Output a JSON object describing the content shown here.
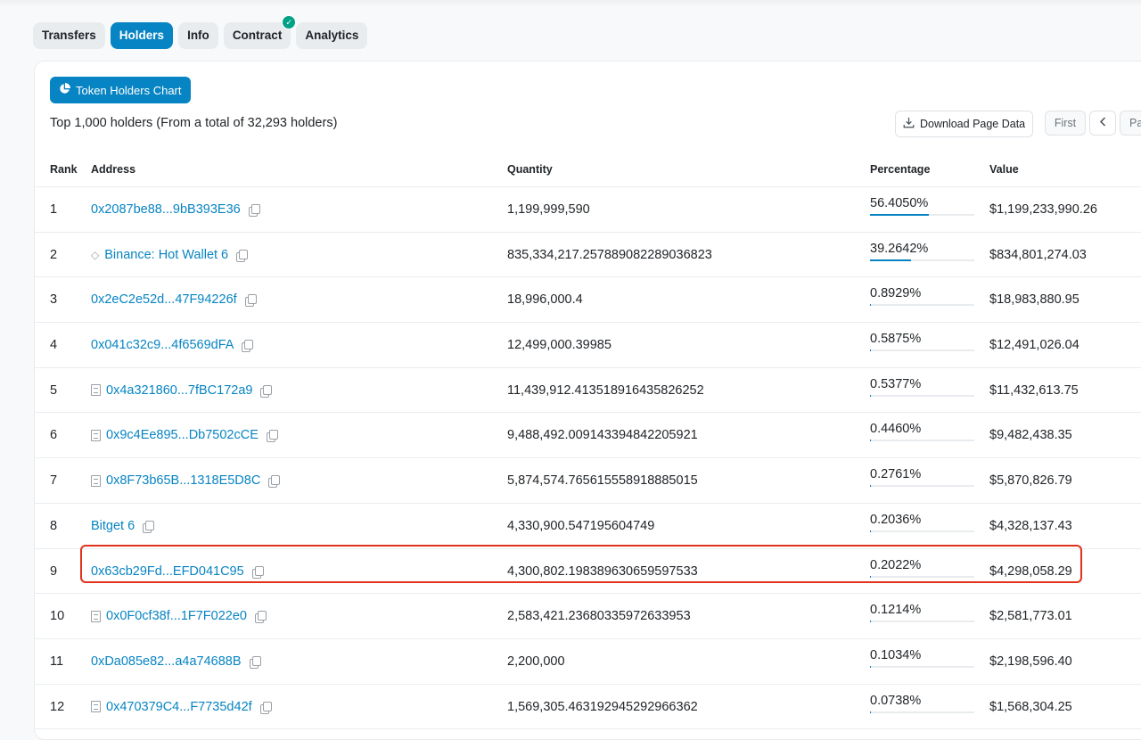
{
  "tabs": [
    {
      "label": "Transfers",
      "active": false
    },
    {
      "label": "Holders",
      "active": true
    },
    {
      "label": "Info",
      "active": false
    },
    {
      "label": "Contract",
      "active": false,
      "verified": true
    },
    {
      "label": "Analytics",
      "active": false
    }
  ],
  "chart_button": {
    "label": "Token Holders Chart",
    "icon": "pie-chart-icon"
  },
  "summary": "Top 1,000 holders (From a total of 32,293 holders)",
  "download_button": {
    "label": "Download Page Data",
    "icon": "download-icon"
  },
  "pagination": {
    "first": "First",
    "prev": "<",
    "page_partial": "Pa"
  },
  "table": {
    "headers": {
      "rank": "Rank",
      "address": "Address",
      "quantity": "Quantity",
      "percentage": "Percentage",
      "value": "Value"
    },
    "rows": [
      {
        "rank": "1",
        "address": "0x2087be88...9bB393E36",
        "icon": "none",
        "quantity": "1,199,999,590",
        "percentage": "56.4050%",
        "pct": 56.405,
        "value": "$1,199,233,990.26"
      },
      {
        "rank": "2",
        "address": "Binance: Hot Wallet 6",
        "icon": "label",
        "quantity": "835,334,217.257889082289036823",
        "percentage": "39.2642%",
        "pct": 39.2642,
        "value": "$834,801,274.03"
      },
      {
        "rank": "3",
        "address": "0x2eC2e52d...47F94226f",
        "icon": "none",
        "quantity": "18,996,000.4",
        "percentage": "0.8929%",
        "pct": 0.8929,
        "value": "$18,983,880.95"
      },
      {
        "rank": "4",
        "address": "0x041c32c9...4f6569dFA",
        "icon": "none",
        "quantity": "12,499,000.39985",
        "percentage": "0.5875%",
        "pct": 0.5875,
        "value": "$12,491,026.04"
      },
      {
        "rank": "5",
        "address": "0x4a321860...7fBC172a9",
        "icon": "contract",
        "quantity": "11,439,912.413518916435826252",
        "percentage": "0.5377%",
        "pct": 0.5377,
        "value": "$11,432,613.75"
      },
      {
        "rank": "6",
        "address": "0x9c4Ee895...Db7502cCE",
        "icon": "contract",
        "quantity": "9,488,492.009143394842205921",
        "percentage": "0.4460%",
        "pct": 0.446,
        "value": "$9,482,438.35"
      },
      {
        "rank": "7",
        "address": "0x8F73b65B...1318E5D8C",
        "icon": "contract",
        "quantity": "5,874,574.765615558918885015",
        "percentage": "0.2761%",
        "pct": 0.2761,
        "value": "$5,870,826.79"
      },
      {
        "rank": "8",
        "address": "Bitget 6",
        "icon": "none",
        "quantity": "4,330,900.547195604749",
        "percentage": "0.2036%",
        "pct": 0.2036,
        "value": "$4,328,137.43"
      },
      {
        "rank": "9",
        "address": "0x63cb29Fd...EFD041C95",
        "icon": "none",
        "quantity": "4,300,802.198389630659597533",
        "percentage": "0.2022%",
        "pct": 0.2022,
        "value": "$4,298,058.29",
        "highlighted": true
      },
      {
        "rank": "10",
        "address": "0x0F0cf38f...1F7F022e0",
        "icon": "contract",
        "quantity": "2,583,421.23680335972633953",
        "percentage": "0.1214%",
        "pct": 0.1214,
        "value": "$2,581,773.01"
      },
      {
        "rank": "11",
        "address": "0xDa085e82...a4a74688B",
        "icon": "none",
        "quantity": "2,200,000",
        "percentage": "0.1034%",
        "pct": 0.1034,
        "value": "$2,198,596.40"
      },
      {
        "rank": "12",
        "address": "0x470379C4...F7735d42f",
        "icon": "contract",
        "quantity": "1,569,305.463192945292966362",
        "percentage": "0.0738%",
        "pct": 0.0738,
        "value": "$1,568,304.25"
      }
    ]
  },
  "colors": {
    "accent": "#0784c3",
    "highlight": "#e0321c",
    "verified": "#00a186"
  }
}
